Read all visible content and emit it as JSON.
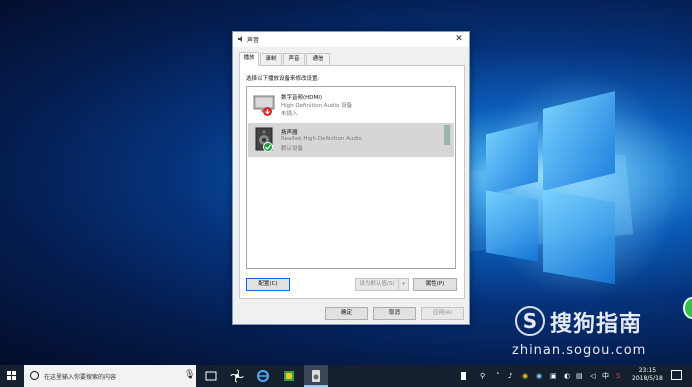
{
  "dialog": {
    "title": "声音",
    "close_glyph": "✕",
    "tabs": [
      {
        "label": "播放"
      },
      {
        "label": "录制"
      },
      {
        "label": "声音"
      },
      {
        "label": "通信"
      }
    ],
    "instruction": "选择以下播放设备来修改设置:",
    "devices": [
      {
        "name": "数字音频(HDMI)",
        "driver": "High Definition Audio 设备",
        "status": "未插入",
        "icon": "monitor-icon",
        "badge": "unplugged-badge"
      },
      {
        "name": "扬声器",
        "driver": "Realtek High Definition Audio",
        "status": "默认设备",
        "icon": "speaker-icon",
        "badge": "default-check-badge"
      }
    ],
    "buttons": {
      "configure": "配置(C)",
      "set_default": "设为默认值(S)",
      "properties": "属性(P)",
      "ok": "确定",
      "cancel": "取消",
      "apply": "应用(A)"
    }
  },
  "watermark": {
    "logo_letter": "S",
    "brand": "搜狗指南",
    "url": "zhinan.sogou.com"
  },
  "taskbar": {
    "search_placeholder": "在这里输入你要搜索的内容",
    "ime": "中",
    "time": "23:15",
    "date": "2018/5/18"
  },
  "colors": {
    "desktop_blue": "#0b5cb8",
    "taskbar": "#15202e",
    "focus_blue": "#0a6cd6",
    "selection_gray": "#d6d6d6"
  }
}
